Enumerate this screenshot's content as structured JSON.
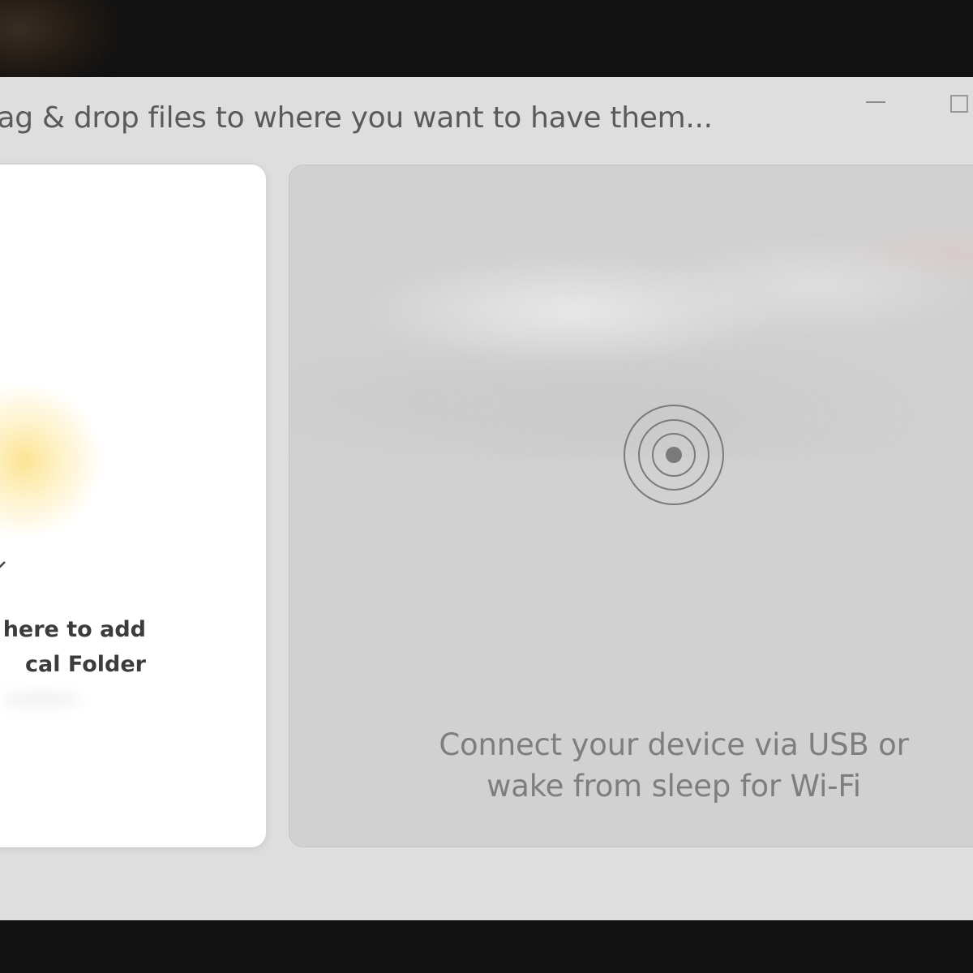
{
  "window": {
    "title": "rag & drop files to where you want to have them..."
  },
  "local_folder_card": {
    "line1": "s here to add",
    "line2": "cal Folder",
    "accent_glow": "#f9cd3c"
  },
  "device_panel": {
    "line1": "Connect your device via USB or",
    "line2": "wake from sleep for Wi-Fi",
    "icon": "signal-rings-icon"
  },
  "colors": {
    "window_bg": "#dedede",
    "card_bg": "#ffffff",
    "panel_bg": "#d1d1d1",
    "desktop_bg": "#121212"
  }
}
